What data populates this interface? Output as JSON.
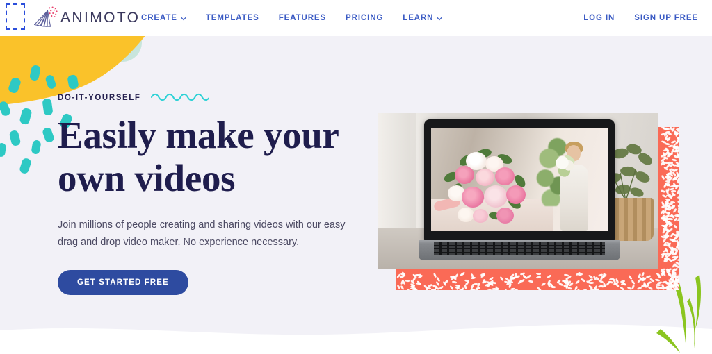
{
  "header": {
    "logo": {
      "icon": "animoto-fan-logo-icon",
      "text": "ANIMOTO"
    },
    "nav": [
      {
        "label": "CREATE",
        "has_dropdown": true
      },
      {
        "label": "TEMPLATES",
        "has_dropdown": false
      },
      {
        "label": "FEATURES",
        "has_dropdown": false
      },
      {
        "label": "PRICING",
        "has_dropdown": false
      },
      {
        "label": "LEARN",
        "has_dropdown": true
      }
    ],
    "auth": [
      {
        "label": "LOG IN"
      },
      {
        "label": "SIGN UP FREE"
      }
    ]
  },
  "hero": {
    "eyebrow": "DO-IT-YOURSELF",
    "title_line1": "Easily make your",
    "title_line2": "own videos",
    "subtitle": "Join millions of people creating and sharing videos with our easy drag and drop video maker. No experience necessary.",
    "cta_label": "GET STARTED FREE",
    "media_alt": "laptop showing wedding bouquet video"
  },
  "colors": {
    "nav_blue": "#3b5bc4",
    "cta_blue": "#2e4ba0",
    "heading_navy": "#1f1d4d",
    "eyebrow_navy": "#241f4e",
    "body_text": "#4c4a63",
    "hero_bg": "#f2f1f7",
    "header_bg": "#ffffff",
    "accent_yellow": "#fac22a",
    "accent_teal": "#2ec9c4",
    "accent_mint": "#c8e5dc",
    "accent_coral": "#fa6a56",
    "accent_green": "#8bc520",
    "logo_text": "#39375c",
    "focus_outline": "#2b4edb"
  }
}
